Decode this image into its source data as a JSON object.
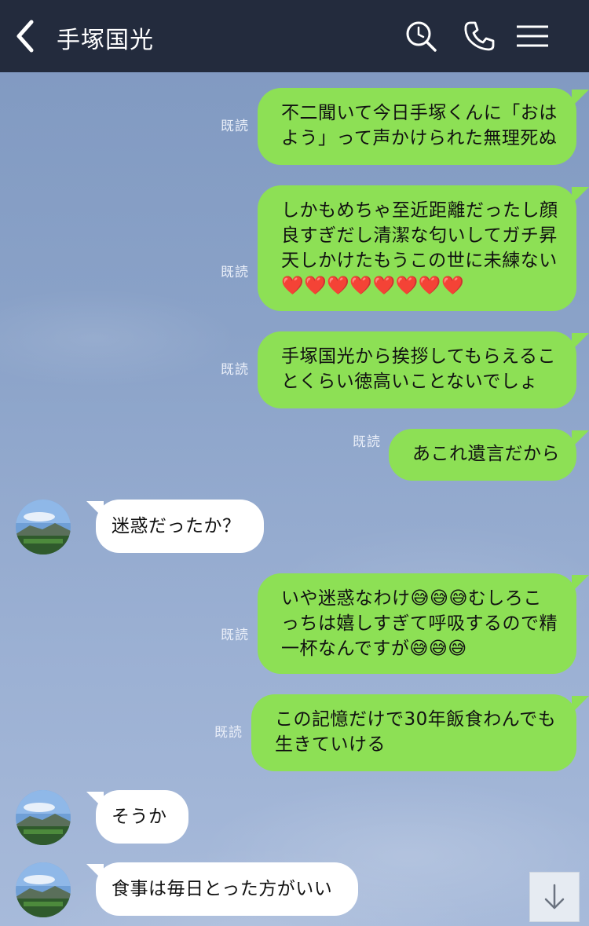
{
  "header": {
    "title": "手塚国光",
    "back_icon": "chevron-left-icon",
    "search_icon": "search-clock-icon",
    "call_icon": "phone-icon",
    "menu_icon": "hamburger-menu-icon"
  },
  "read_label": "既読",
  "messages": [
    {
      "dir": "out",
      "text": "不二聞いて今日手塚くんに「おは\nよう」って声かけられた無理死ぬ",
      "read": "既読"
    },
    {
      "dir": "out",
      "text": "しかもめちゃ至近距離だったし顔\n良すぎだし清潔な匂いしてガチ昇\n天しかけたもうこの世に未練ない\n❤️❤️❤️❤️❤️❤️❤️❤️",
      "read": "既読"
    },
    {
      "dir": "out",
      "text": "手塚国光から挨拶してもらえるこ\nとくらい徳高いことないでしょ",
      "read": "既読"
    },
    {
      "dir": "out",
      "text": "あこれ遺言だから",
      "read": "既読"
    },
    {
      "dir": "in",
      "text": "迷惑だったか？"
    },
    {
      "dir": "out",
      "text": "いや迷惑なわけ😅😅😅むしろこ\nっちは嬉しすぎて呼吸するので精\n一杯なんですが😅😅😅",
      "read": "既読"
    },
    {
      "dir": "out",
      "text": "この記憶だけで30年飯食わんでも\n生きていける",
      "read": "既読"
    },
    {
      "dir": "in",
      "text": "そうか"
    },
    {
      "dir": "in",
      "text": "食事は毎日とった方がいい"
    }
  ],
  "colors": {
    "header_bg": "#232b3d",
    "bubble_out": "#8de055",
    "bubble_in": "#ffffff"
  },
  "scroll_button_icon": "arrow-down-icon"
}
